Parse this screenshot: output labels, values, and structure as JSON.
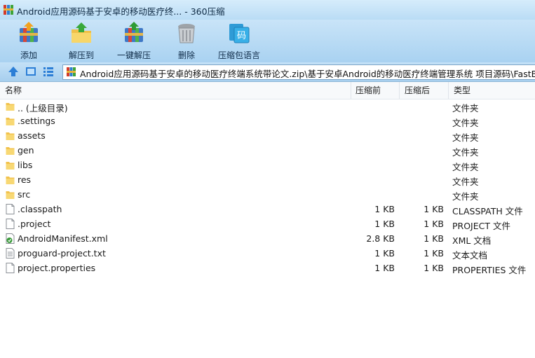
{
  "window": {
    "title": "Android应用源码基于安卓的移动医疗终... - 360压缩"
  },
  "toolbar": {
    "buttons": [
      {
        "label": "添加",
        "icon": "add-archive-icon"
      },
      {
        "label": "解压到",
        "icon": "extract-to-icon"
      },
      {
        "label": "一键解压",
        "icon": "one-click-extract-icon"
      },
      {
        "label": "删除",
        "icon": "delete-trash-icon"
      },
      {
        "label": "压缩包语言",
        "icon": "archive-language-icon"
      }
    ]
  },
  "address": {
    "path": "Android应用源码基于安卓的移动医疗终端系统带论文.zip\\基于安卓Android的移动医疗终端管理系统 项目源码\\FastBlood"
  },
  "columns": {
    "name": "名称",
    "before": "压缩前",
    "after": "压缩后",
    "type": "类型"
  },
  "files": [
    {
      "name": ".. (上级目录)",
      "before": "",
      "after": "",
      "type": "文件夹",
      "kind": "folder"
    },
    {
      "name": ".settings",
      "before": "",
      "after": "",
      "type": "文件夹",
      "kind": "folder"
    },
    {
      "name": "assets",
      "before": "",
      "after": "",
      "type": "文件夹",
      "kind": "folder"
    },
    {
      "name": "gen",
      "before": "",
      "after": "",
      "type": "文件夹",
      "kind": "folder"
    },
    {
      "name": "libs",
      "before": "",
      "after": "",
      "type": "文件夹",
      "kind": "folder"
    },
    {
      "name": "res",
      "before": "",
      "after": "",
      "type": "文件夹",
      "kind": "folder"
    },
    {
      "name": "src",
      "before": "",
      "after": "",
      "type": "文件夹",
      "kind": "folder"
    },
    {
      "name": ".classpath",
      "before": "1 KB",
      "after": "1 KB",
      "type": "CLASSPATH 文件",
      "kind": "file"
    },
    {
      "name": ".project",
      "before": "1 KB",
      "after": "1 KB",
      "type": "PROJECT 文件",
      "kind": "file"
    },
    {
      "name": "AndroidManifest.xml",
      "before": "2.8 KB",
      "after": "1 KB",
      "type": "XML 文档",
      "kind": "xml"
    },
    {
      "name": "proguard-project.txt",
      "before": "1 KB",
      "after": "1 KB",
      "type": "文本文档",
      "kind": "text"
    },
    {
      "name": "project.properties",
      "before": "1 KB",
      "after": "1 KB",
      "type": "PROPERTIES 文件",
      "kind": "file"
    }
  ]
}
